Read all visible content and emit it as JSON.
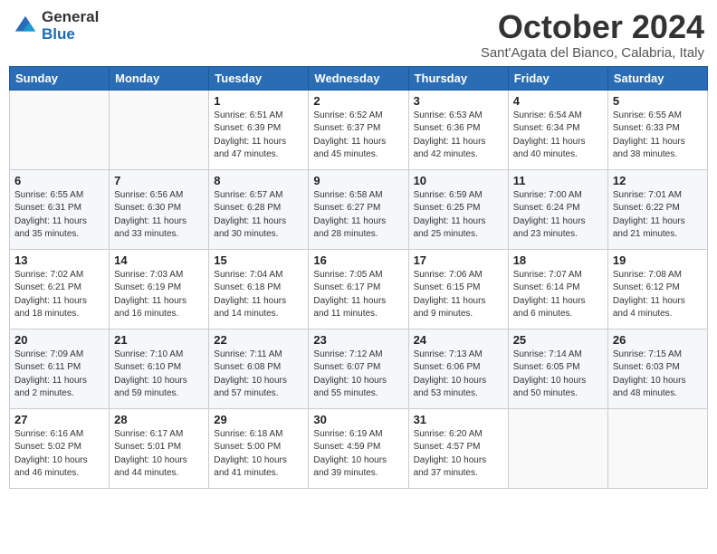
{
  "logo": {
    "general": "General",
    "blue": "Blue"
  },
  "title": "October 2024",
  "subtitle": "Sant'Agata del Bianco, Calabria, Italy",
  "headers": [
    "Sunday",
    "Monday",
    "Tuesday",
    "Wednesday",
    "Thursday",
    "Friday",
    "Saturday"
  ],
  "weeks": [
    [
      {
        "day": "",
        "info": ""
      },
      {
        "day": "",
        "info": ""
      },
      {
        "day": "1",
        "info": "Sunrise: 6:51 AM\nSunset: 6:39 PM\nDaylight: 11 hours and 47 minutes."
      },
      {
        "day": "2",
        "info": "Sunrise: 6:52 AM\nSunset: 6:37 PM\nDaylight: 11 hours and 45 minutes."
      },
      {
        "day": "3",
        "info": "Sunrise: 6:53 AM\nSunset: 6:36 PM\nDaylight: 11 hours and 42 minutes."
      },
      {
        "day": "4",
        "info": "Sunrise: 6:54 AM\nSunset: 6:34 PM\nDaylight: 11 hours and 40 minutes."
      },
      {
        "day": "5",
        "info": "Sunrise: 6:55 AM\nSunset: 6:33 PM\nDaylight: 11 hours and 38 minutes."
      }
    ],
    [
      {
        "day": "6",
        "info": "Sunrise: 6:55 AM\nSunset: 6:31 PM\nDaylight: 11 hours and 35 minutes."
      },
      {
        "day": "7",
        "info": "Sunrise: 6:56 AM\nSunset: 6:30 PM\nDaylight: 11 hours and 33 minutes."
      },
      {
        "day": "8",
        "info": "Sunrise: 6:57 AM\nSunset: 6:28 PM\nDaylight: 11 hours and 30 minutes."
      },
      {
        "day": "9",
        "info": "Sunrise: 6:58 AM\nSunset: 6:27 PM\nDaylight: 11 hours and 28 minutes."
      },
      {
        "day": "10",
        "info": "Sunrise: 6:59 AM\nSunset: 6:25 PM\nDaylight: 11 hours and 25 minutes."
      },
      {
        "day": "11",
        "info": "Sunrise: 7:00 AM\nSunset: 6:24 PM\nDaylight: 11 hours and 23 minutes."
      },
      {
        "day": "12",
        "info": "Sunrise: 7:01 AM\nSunset: 6:22 PM\nDaylight: 11 hours and 21 minutes."
      }
    ],
    [
      {
        "day": "13",
        "info": "Sunrise: 7:02 AM\nSunset: 6:21 PM\nDaylight: 11 hours and 18 minutes."
      },
      {
        "day": "14",
        "info": "Sunrise: 7:03 AM\nSunset: 6:19 PM\nDaylight: 11 hours and 16 minutes."
      },
      {
        "day": "15",
        "info": "Sunrise: 7:04 AM\nSunset: 6:18 PM\nDaylight: 11 hours and 14 minutes."
      },
      {
        "day": "16",
        "info": "Sunrise: 7:05 AM\nSunset: 6:17 PM\nDaylight: 11 hours and 11 minutes."
      },
      {
        "day": "17",
        "info": "Sunrise: 7:06 AM\nSunset: 6:15 PM\nDaylight: 11 hours and 9 minutes."
      },
      {
        "day": "18",
        "info": "Sunrise: 7:07 AM\nSunset: 6:14 PM\nDaylight: 11 hours and 6 minutes."
      },
      {
        "day": "19",
        "info": "Sunrise: 7:08 AM\nSunset: 6:12 PM\nDaylight: 11 hours and 4 minutes."
      }
    ],
    [
      {
        "day": "20",
        "info": "Sunrise: 7:09 AM\nSunset: 6:11 PM\nDaylight: 11 hours and 2 minutes."
      },
      {
        "day": "21",
        "info": "Sunrise: 7:10 AM\nSunset: 6:10 PM\nDaylight: 10 hours and 59 minutes."
      },
      {
        "day": "22",
        "info": "Sunrise: 7:11 AM\nSunset: 6:08 PM\nDaylight: 10 hours and 57 minutes."
      },
      {
        "day": "23",
        "info": "Sunrise: 7:12 AM\nSunset: 6:07 PM\nDaylight: 10 hours and 55 minutes."
      },
      {
        "day": "24",
        "info": "Sunrise: 7:13 AM\nSunset: 6:06 PM\nDaylight: 10 hours and 53 minutes."
      },
      {
        "day": "25",
        "info": "Sunrise: 7:14 AM\nSunset: 6:05 PM\nDaylight: 10 hours and 50 minutes."
      },
      {
        "day": "26",
        "info": "Sunrise: 7:15 AM\nSunset: 6:03 PM\nDaylight: 10 hours and 48 minutes."
      }
    ],
    [
      {
        "day": "27",
        "info": "Sunrise: 6:16 AM\nSunset: 5:02 PM\nDaylight: 10 hours and 46 minutes."
      },
      {
        "day": "28",
        "info": "Sunrise: 6:17 AM\nSunset: 5:01 PM\nDaylight: 10 hours and 44 minutes."
      },
      {
        "day": "29",
        "info": "Sunrise: 6:18 AM\nSunset: 5:00 PM\nDaylight: 10 hours and 41 minutes."
      },
      {
        "day": "30",
        "info": "Sunrise: 6:19 AM\nSunset: 4:59 PM\nDaylight: 10 hours and 39 minutes."
      },
      {
        "day": "31",
        "info": "Sunrise: 6:20 AM\nSunset: 4:57 PM\nDaylight: 10 hours and 37 minutes."
      },
      {
        "day": "",
        "info": ""
      },
      {
        "day": "",
        "info": ""
      }
    ]
  ]
}
